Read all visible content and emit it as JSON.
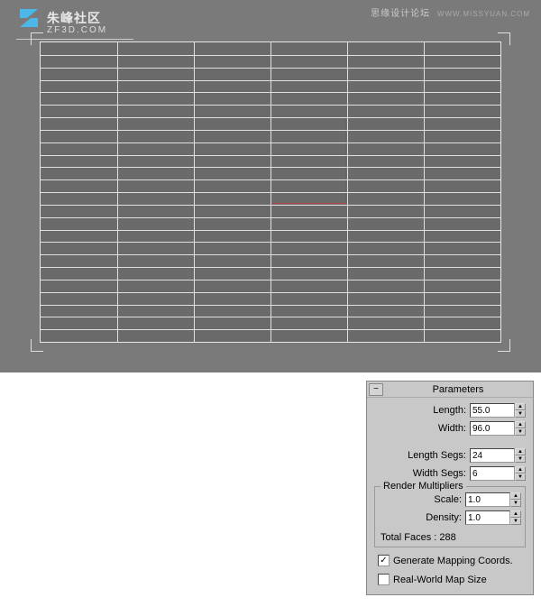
{
  "header": {
    "logo_text": "朱峰社区",
    "logo_sub": "ZF3D.COM",
    "watermark": "思缘设计论坛",
    "watermark_url": "WWW.MISSYUAN.COM"
  },
  "grid": {
    "width_segs": 6,
    "length_segs": 24
  },
  "panel": {
    "title": "Parameters",
    "collapse": "−",
    "length_label": "Length:",
    "length_value": "55.0",
    "width_label": "Width:",
    "width_value": "96.0",
    "lsegs_label": "Length Segs:",
    "lsegs_value": "24",
    "wsegs_label": "Width Segs:",
    "wsegs_value": "6",
    "multipliers_label": "Render Multipliers",
    "scale_label": "Scale:",
    "scale_value": "1.0",
    "density_label": "Density:",
    "density_value": "1.0",
    "total_faces": "Total Faces : 288",
    "mapping_label": "Generate Mapping Coords.",
    "mapping_checked": true,
    "realworld_label": "Real-World Map Size",
    "realworld_checked": false
  }
}
